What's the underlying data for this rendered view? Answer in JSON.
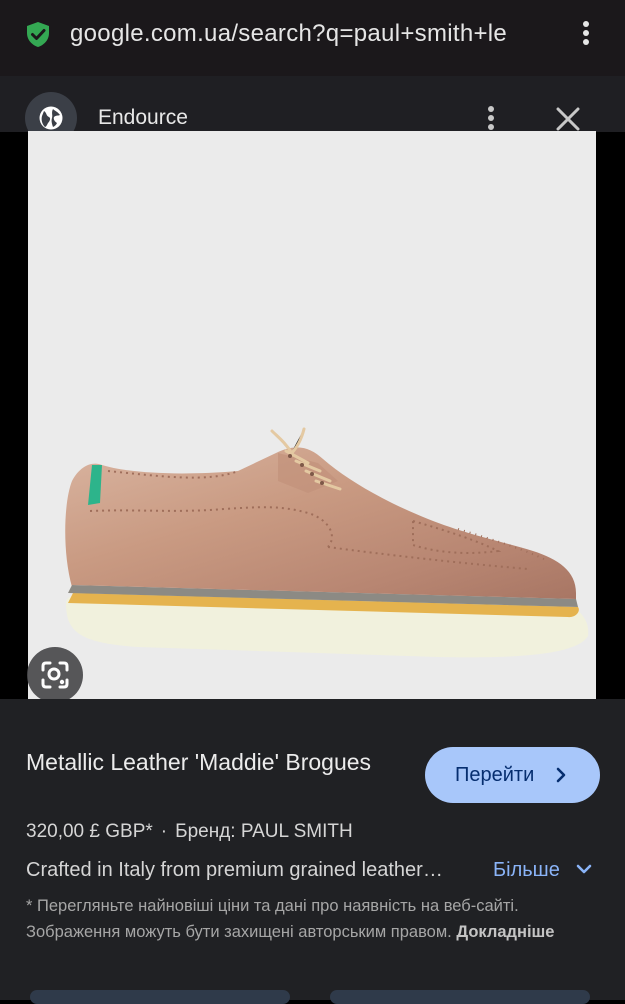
{
  "browser": {
    "url": "google.com.ua/search?q=paul+smith+le",
    "security_icon": "shield-check-icon",
    "menu_icon": "more-vert-icon"
  },
  "source_strip": {
    "site_name": "Endource",
    "site_icon": "globe-icon",
    "menu_icon": "more-vert-icon",
    "close_icon": "close-icon"
  },
  "product": {
    "title": "Metallic Leather 'Maddie' Brogues",
    "price": "320,00 £ GBP*",
    "separator": "·",
    "brand": "Бренд: PAUL SMITH",
    "description": "Crafted in Italy from premium grained leather…",
    "more_label": "Більше",
    "goto_label": "Перейти",
    "note_text": "* Перегляньте найновіші ціни та дані про наявність на веб-сайті. Зображення можуть бути захищені авторським правом.",
    "note_link": "Докладніше"
  },
  "colors": {
    "accent_button": "#a8c7fa",
    "link": "#8ab4f8",
    "security_green": "#34a853"
  }
}
